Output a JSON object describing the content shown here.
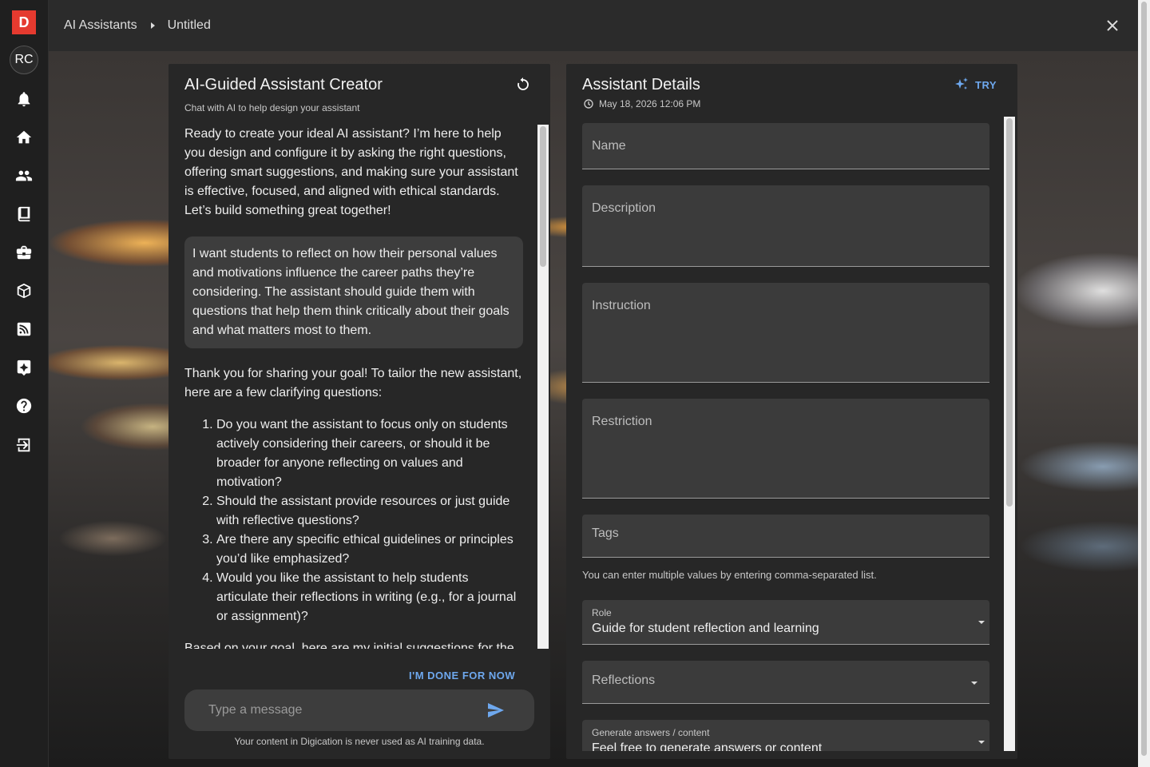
{
  "nav": {
    "logo": "D",
    "avatar_initials": "RC",
    "items": [
      {
        "icon": "bell-icon"
      },
      {
        "icon": "home-icon"
      },
      {
        "icon": "people-icon"
      },
      {
        "icon": "book-icon"
      },
      {
        "icon": "briefcase-icon"
      },
      {
        "icon": "box-icon"
      },
      {
        "icon": "feed-icon"
      },
      {
        "icon": "ai-badge-icon"
      },
      {
        "icon": "help-icon"
      },
      {
        "icon": "sign-in-icon"
      }
    ]
  },
  "breadcrumb": {
    "root": "AI Assistants",
    "current": "Untitled"
  },
  "creator": {
    "title": "AI-Guided Assistant Creator",
    "subtitle": "Chat with AI to help design your assistant",
    "intro": "Ready to create your ideal AI assistant? I’m here to help you design and configure it by asking the right questions, offering smart suggestions, and making sure your assistant is effective, focused, and aligned with ethical standards. Let’s build something great together!",
    "user_message": "I want students to reflect on how their personal values and motivations influence the career paths they’re considering. The assistant should guide them with questions that help them think critically about their goals and what matters most to them.",
    "reply_intro": "Thank you for sharing your goal! To tailor the new assistant, here are a few clarifying questions:",
    "questions": [
      "Do you want the assistant to focus only on students actively considering their careers, or should it be broader for anyone reflecting on values and motivation?",
      "Should the assistant provide resources or just guide with reflective questions?",
      "Are there any specific ethical guidelines or principles you’d like emphasized?",
      "Would you like the assistant to help students articulate their reflections in writing (e.g., for a journal or assignment)?"
    ],
    "reply_tail": "Based on your goal, here are my initial suggestions for the",
    "done_label": "I'M DONE FOR NOW",
    "input_placeholder": "Type a message",
    "footnote": "Your content in Digication is never used as AI training data."
  },
  "details": {
    "title": "Assistant Details",
    "try_label": "TRY",
    "date": "May 18, 2026 12:06 PM",
    "fields": {
      "name": "Name",
      "description": "Description",
      "instruction": "Instruction",
      "restriction": "Restriction",
      "tags": "Tags"
    },
    "tags_helper": "You can enter multiple values by entering comma-separated list.",
    "role_label": "Role",
    "role_value": "Guide for student reflection and learning",
    "reflections_label": "Reflections",
    "generate_label": "Generate answers / content",
    "generate_value": "Feel free to generate answers or content"
  },
  "colors": {
    "accent": "#6ea8ee",
    "logo": "#e53a2f",
    "panel": "#272727",
    "field": "#3b3b3b"
  }
}
